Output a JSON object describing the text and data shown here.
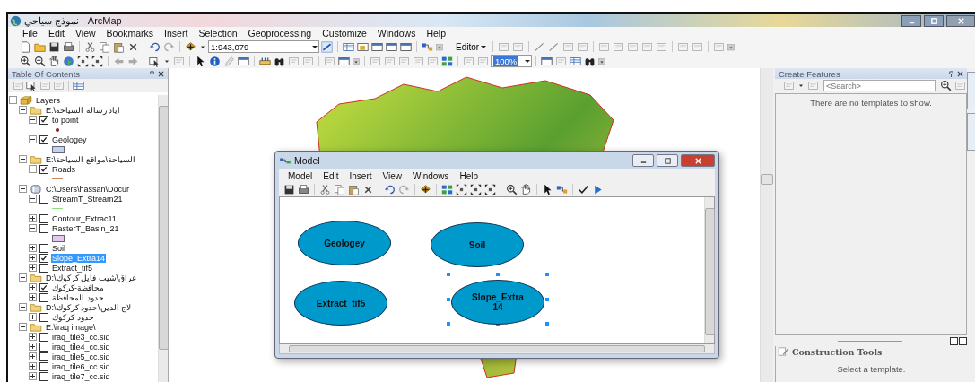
{
  "window": {
    "title": "نموذج سياحي - ArcMap"
  },
  "menu": [
    "File",
    "Edit",
    "View",
    "Bookmarks",
    "Insert",
    "Selection",
    "Geoprocessing",
    "Customize",
    "Windows",
    "Help"
  ],
  "toolbar": {
    "scale": "1:943,079",
    "editor": "Editor",
    "zoom": "100%"
  },
  "toc": {
    "title": "Table Of Contents",
    "tree": [
      {
        "kind": "group",
        "label": "Layers",
        "expanded": true,
        "children": [
          {
            "kind": "folder",
            "label": "E:\\اياد رسالة السياحة",
            "expanded": true,
            "children": [
              {
                "label": "to point",
                "expanded": true,
                "checked": true,
                "selected": false,
                "legend": {
                  "kind": "point",
                  "color": "#8b1a1a"
                }
              },
              {
                "label": "Geologey",
                "expanded": true,
                "checked": true,
                "selected": false,
                "legend": {
                  "kind": "fill",
                  "color": "#bcd4f0"
                }
              }
            ]
          },
          {
            "kind": "folder",
            "label": "E:\\السياحة\\مواقع السياحة",
            "expanded": true,
            "children": [
              {
                "label": "Roads",
                "expanded": true,
                "checked": true,
                "selected": false,
                "legend": {
                  "kind": "line",
                  "color": "#c8865a"
                }
              }
            ]
          },
          {
            "kind": "database",
            "label": "C:\\Users\\hassan\\Docur",
            "expanded": true,
            "children": [
              {
                "label": "StreamT_Stream21",
                "expanded": true,
                "checked": false,
                "selected": false,
                "legend": {
                  "kind": "line",
                  "color": "#8fe07a"
                }
              },
              {
                "label": "Contour_Extrac11",
                "expanded": false,
                "checked": false,
                "selected": false
              },
              {
                "label": "RasterT_Basin_21",
                "expanded": true,
                "checked": false,
                "selected": false,
                "legend": {
                  "kind": "fill",
                  "color": "#e6c8ec"
                }
              },
              {
                "label": "Soil",
                "expanded": false,
                "checked": false,
                "selected": false
              },
              {
                "label": "Slope_Extra14",
                "expanded": false,
                "checked": true,
                "selected": true
              },
              {
                "label": "Extract_tif5",
                "expanded": false,
                "checked": false,
                "selected": false
              }
            ]
          },
          {
            "kind": "folder",
            "label": "D:\\عراق\\شيب فايل كركوك",
            "expanded": true,
            "children": [
              {
                "label": "محافظة-كركوك",
                "expanded": false,
                "checked": true,
                "selected": false
              },
              {
                "label": "حدود المحافظة",
                "expanded": false,
                "checked": false,
                "selected": false
              }
            ]
          },
          {
            "kind": "folder",
            "label": "D:\\لاج الدين\\حدود كركوك",
            "expanded": true,
            "children": [
              {
                "label": "حدود كركوك",
                "expanded": false,
                "checked": false,
                "selected": false
              }
            ]
          },
          {
            "kind": "folder",
            "label": "E:\\iraq image\\",
            "expanded": true,
            "children": [
              {
                "label": "iraq_tile3_cc.sid",
                "expanded": false,
                "checked": false,
                "selected": false
              },
              {
                "label": "iraq_tile4_cc.sid",
                "expanded": false,
                "checked": false,
                "selected": false
              },
              {
                "label": "iraq_tile5_cc.sid",
                "expanded": false,
                "checked": false,
                "selected": false
              },
              {
                "label": "iraq_tile6_cc.sid",
                "expanded": false,
                "checked": false,
                "selected": false
              },
              {
                "label": "iraq_tile7_cc.sid",
                "expanded": false,
                "checked": false,
                "selected": false
              }
            ]
          }
        ]
      }
    ]
  },
  "model_window": {
    "title": "Model",
    "menu": [
      "Model",
      "Edit",
      "Insert",
      "View",
      "Windows",
      "Help"
    ],
    "elements": [
      {
        "label": "Geologey",
        "selected": false
      },
      {
        "label": "Soil",
        "selected": false
      },
      {
        "label": "Extract_tif5",
        "selected": false
      },
      {
        "label": "Slope_Extra14",
        "selected": true
      }
    ]
  },
  "create_features": {
    "title": "Create Features",
    "search": {
      "placeholder": "<Search>"
    },
    "message": "There are no templates to show."
  },
  "construction_tools": {
    "title": "Construction Tools",
    "message": "Select a template."
  }
}
